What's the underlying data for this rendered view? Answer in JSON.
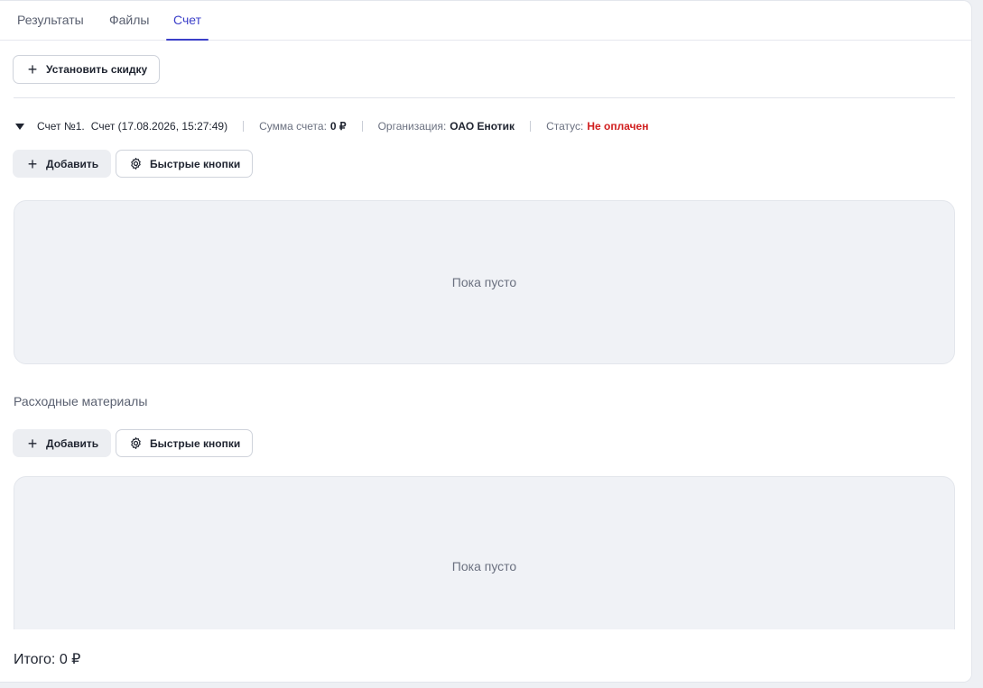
{
  "tabs": [
    {
      "label": "Результаты",
      "active": false
    },
    {
      "label": "Файлы",
      "active": false
    },
    {
      "label": "Счет",
      "active": true
    }
  ],
  "discount_button": {
    "label": "Установить скидку",
    "icon": "plus-icon"
  },
  "invoice": {
    "title": "Счет №1.",
    "name": "Счет (17.08.2026, 15:27:49)",
    "sum_label": "Сумма счета:",
    "sum_value": "0 ₽",
    "org_label": "Организация:",
    "org_value": "ОАО Енотик",
    "status_label": "Статус:",
    "status_value": "Не оплачен",
    "status_color": "#d11f1f"
  },
  "services": {
    "add_label": "Добавить",
    "quick_label": "Быстрые кнопки",
    "empty_text": "Пока пусто"
  },
  "materials": {
    "title": "Расходные материалы",
    "add_label": "Добавить",
    "quick_label": "Быстрые кнопки",
    "empty_text": "Пока пусто"
  },
  "footer": {
    "total": "Итого: 0 ₽"
  },
  "colors": {
    "accent": "#3b3fc9",
    "status_unpaid": "#d11f1f"
  }
}
